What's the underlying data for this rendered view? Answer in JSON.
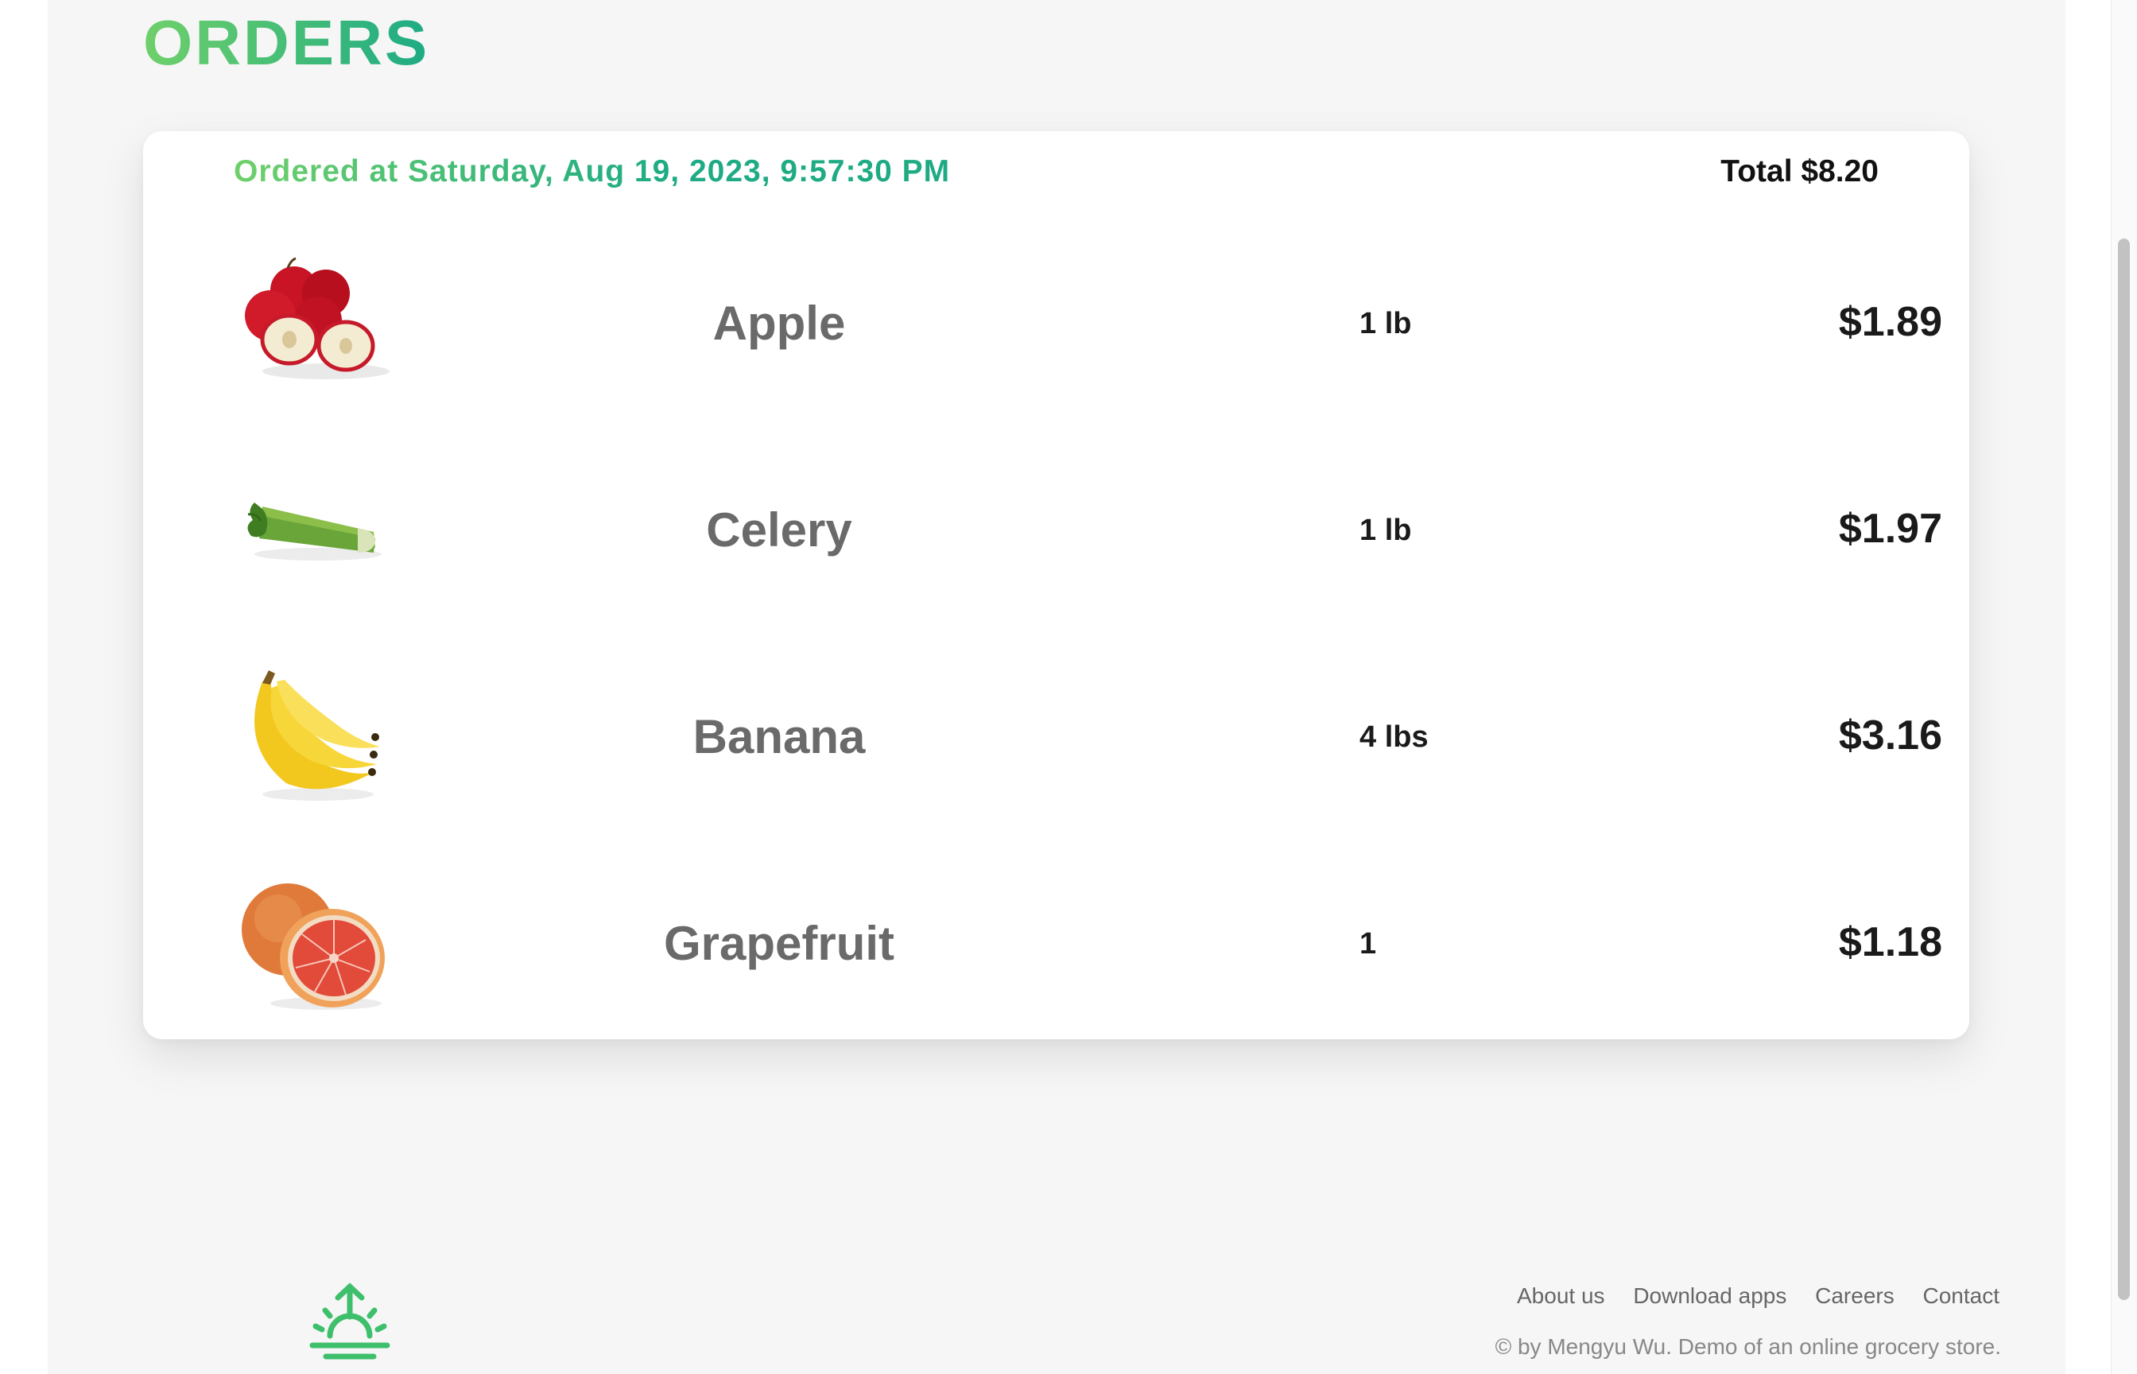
{
  "page": {
    "title": "ORDERS"
  },
  "order": {
    "ordered_at": "Ordered at Saturday, Aug 19, 2023, 9:57:30 PM",
    "total": "Total $8.20",
    "items": [
      {
        "name": "Apple",
        "quantity": "1 lb",
        "price": "$1.89",
        "image": "apple-image"
      },
      {
        "name": "Celery",
        "quantity": "1 lb",
        "price": "$1.97",
        "image": "celery-image"
      },
      {
        "name": "Banana",
        "quantity": "4 lbs",
        "price": "$3.16",
        "image": "banana-image"
      },
      {
        "name": "Grapefruit",
        "quantity": "1",
        "price": "$1.18",
        "image": "grapefruit-image"
      }
    ]
  },
  "footer": {
    "links": [
      "About us",
      "Download apps",
      "Careers",
      "Contact"
    ],
    "copyright": "© by Mengyu Wu. Demo of an online grocery store.",
    "logo_icon": "sunrise-logo-icon"
  },
  "colors": {
    "brand_green_start": "#6fd06a",
    "brand_green_end": "#1eab84",
    "text_dark": "#1a1a1a",
    "text_gray": "#6a6a6a"
  }
}
